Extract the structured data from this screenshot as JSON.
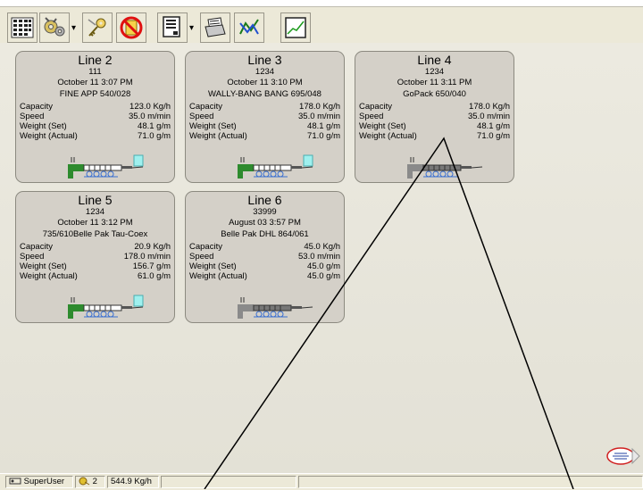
{
  "toolbar": {
    "icons": [
      "grid-view-icon",
      "machine-settings-icon",
      "keys-icon",
      "no-entry-icon",
      "document-icon",
      "print-icon",
      "chart-tool-icon",
      "graph-window-icon"
    ]
  },
  "cards": [
    {
      "title": "Line 2",
      "id": "111",
      "date": "October 11 3:07 PM",
      "product": "FINE APP 540/028",
      "capacity_label": "Capacity",
      "capacity": "123.0 Kg/h",
      "speed_label": "Speed",
      "speed": "35.0 m/min",
      "wset_label": "Weight (Set)",
      "wset": "48.1 g/m",
      "wact_label": "Weight (Actual)",
      "wact": "71.0 g/m"
    },
    {
      "title": "Line 3",
      "id": "1234",
      "date": "October 11 3:10 PM",
      "product": "WALLY-BANG BANG 695/048",
      "capacity_label": "Capacity",
      "capacity": "178.0 Kg/h",
      "speed_label": "Speed",
      "speed": "35.0 m/min",
      "wset_label": "Weight (Set)",
      "wset": "48.1 g/m",
      "wact_label": "Weight (Actual)",
      "wact": "71.0 g/m"
    },
    {
      "title": "Line 4",
      "id": "1234",
      "date": "October 11 3:11 PM",
      "product": "GoPack 650/040",
      "capacity_label": "Capacity",
      "capacity": "178.0 Kg/h",
      "speed_label": "Speed",
      "speed": "35.0 m/min",
      "wset_label": "Weight (Set)",
      "wset": "48.1 g/m",
      "wact_label": "Weight (Actual)",
      "wact": "71.0 g/m"
    },
    {
      "title": "Line 5",
      "id": "1234",
      "date": "October 11 3:12 PM",
      "product": "735/610Belle Pak Tau-Coex",
      "capacity_label": "Capacity",
      "capacity": "20.9 Kg/h",
      "speed_label": "Speed",
      "speed": "178.0 m/min",
      "wset_label": "Weight (Set)",
      "wset": "156.7 g/m",
      "wact_label": "Weight (Actual)",
      "wact": "61.0 g/m"
    },
    {
      "title": "Line 6",
      "id": "33999",
      "date": "August 03 3:57 PM",
      "product": "Belle Pak DHL 864/061",
      "capacity_label": "Capacity",
      "capacity": "45.0 Kg/h",
      "speed_label": "Speed",
      "speed": "53.0 m/min",
      "wset_label": "Weight (Set)",
      "wset": "45.0 g/m",
      "wact_label": "Weight (Actual)",
      "wact": "45.0 g/m"
    }
  ],
  "status": {
    "user": "SuperUser",
    "count": "2",
    "total": "544.9 Kg/h"
  },
  "colors": {
    "accent_green": "#2e8b2e",
    "accent_cyan": "#9ff0ee",
    "roller_blue": "#3a6fd0"
  }
}
